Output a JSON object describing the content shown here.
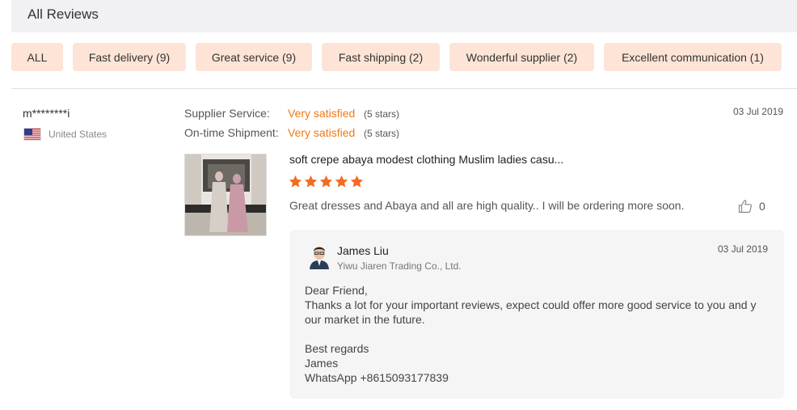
{
  "header": {
    "title": "All Reviews"
  },
  "tags": [
    {
      "label": "ALL"
    },
    {
      "label": "Fast delivery (9)"
    },
    {
      "label": "Great service (9)"
    },
    {
      "label": "Fast shipping (2)"
    },
    {
      "label": "Wonderful supplier (2)"
    },
    {
      "label": "Excellent communication (1)"
    }
  ],
  "review": {
    "user": "m********i",
    "country": "United States",
    "date": "03 Jul 2019",
    "ratings": [
      {
        "label": "Supplier Service:",
        "value": "Very satisfied",
        "stars": "(5 stars)"
      },
      {
        "label": "On-time Shipment:",
        "value": "Very satisfied",
        "stars": "(5 stars)"
      }
    ],
    "product_title": "soft crepe abaya modest clothing Muslim ladies casu...",
    "star_count": 5,
    "star_color": "#f26c21",
    "text": "Great dresses and Abaya and all are high quality.. I will be ordering more soon.",
    "likes": "0"
  },
  "reply": {
    "name": "James Liu",
    "company": "Yiwu Jiaren Trading Co., Ltd.",
    "date": "03 Jul 2019",
    "lines": {
      "l1": "Dear Friend,",
      "l2": "Thanks a lot for your important reviews, expect could offer more good service to you and y",
      "l3": "our market in the future.",
      "l4": "Best regards",
      "l5": "James",
      "l6": "WhatsApp +8615093177839"
    }
  }
}
